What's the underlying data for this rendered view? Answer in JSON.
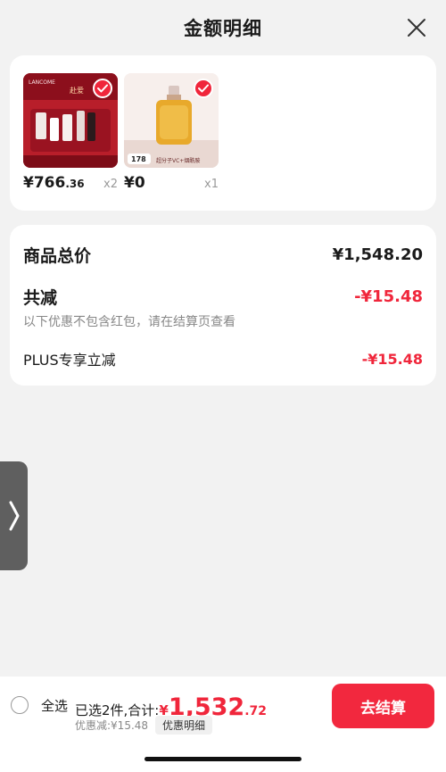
{
  "header": {
    "title": "金额明细"
  },
  "products": [
    {
      "price_main": "¥766",
      "price_cents": ".36",
      "qty": "x2",
      "brand": "LANCOME",
      "tag": "赴爱"
    },
    {
      "price_main": "¥0",
      "price_cents": "",
      "qty": "x1",
      "badge": "178",
      "caption": "超分子VC+烟酰胺"
    }
  ],
  "summary": {
    "total_label": "商品总价",
    "total_value": "¥1,548.20",
    "discount_label": "共减",
    "discount_value": "-¥15.48",
    "note": "以下优惠不包含红包，请在结算页查看",
    "plus_label": "PLUS专享立减",
    "plus_value": "-¥15.48"
  },
  "bottom": {
    "select_all": "全选",
    "selected_text": "已选2件,合计:",
    "yen": "¥",
    "price_big": "1,532",
    "price_small": ".72",
    "discount_text": "优惠减:¥15.48",
    "detail_chip": "优惠明细",
    "checkout": "去结算"
  },
  "colors": {
    "accent": "#f0263b",
    "background": "#f2f2f2"
  }
}
